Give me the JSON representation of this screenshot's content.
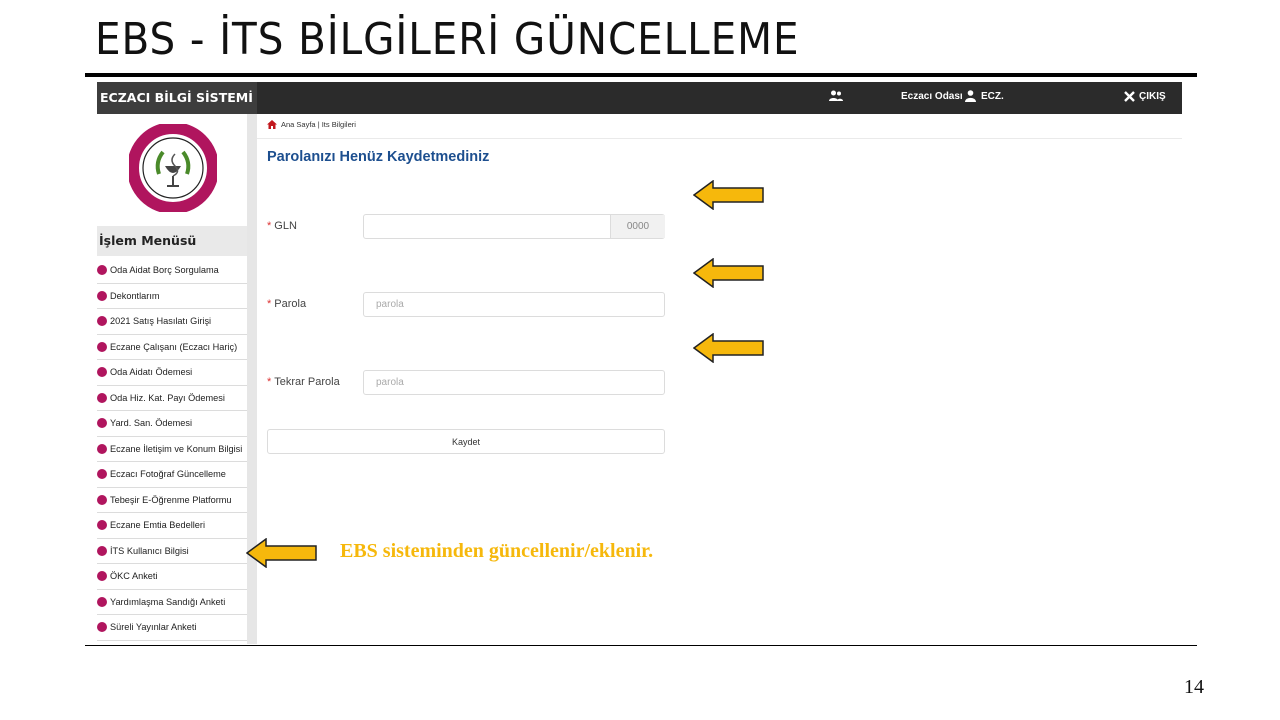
{
  "slide": {
    "title": "EBS - İTS BİLGİLERİ GÜNCELLEME",
    "page_number": "14",
    "annotation": "EBS sisteminden güncellenir/eklenir."
  },
  "app": {
    "brand": "ECZACI BİLGİ SİSTEMİ",
    "user_role": "Eczacı Odası",
    "user_name": "ECZ.",
    "logout_label": "ÇIKIŞ"
  },
  "sidebar": {
    "menu_title": "İşlem Menüsü",
    "items": [
      {
        "label": "Oda Aidat Borç Sorgulama"
      },
      {
        "label": "Dekontlarım"
      },
      {
        "label": "2021 Satış Hasılatı Girişi"
      },
      {
        "label": "Eczane Çalışanı (Eczacı Hariç)"
      },
      {
        "label": "Oda Aidatı Ödemesi"
      },
      {
        "label": "Oda Hiz. Kat. Payı Ödemesi"
      },
      {
        "label": "Yard. San. Ödemesi"
      },
      {
        "label": "Eczane İletişim ve Konum Bilgisi"
      },
      {
        "label": "Eczacı Fotoğraf Güncelleme"
      },
      {
        "label": "Tebeşir E-Öğrenme Platformu"
      },
      {
        "label": "Eczane Emtia Bedelleri"
      },
      {
        "label": "İTS Kullanıcı Bilgisi"
      },
      {
        "label": "ÖKC Anketi"
      },
      {
        "label": "Yardımlaşma Sandığı Anketi"
      },
      {
        "label": "Süreli Yayınlar Anketi"
      }
    ]
  },
  "breadcrumb": {
    "text": "Ana Sayfa | Its Bilgileri"
  },
  "form": {
    "title": "Parolanızı Henüz Kaydetmediniz",
    "required_mark": "*",
    "gln_label": "GLN",
    "gln_value": "",
    "gln_addon": "0000",
    "password_label": "Parola",
    "password_placeholder": "parola",
    "password_repeat_label": "Tekrar Parola",
    "password_repeat_placeholder": "parola",
    "save_label": "Kaydet"
  },
  "colors": {
    "arrow": "#f6b80c",
    "accent_dot": "#b0155e",
    "form_title": "#1d4f8f",
    "topbar": "#2b2b2b"
  }
}
